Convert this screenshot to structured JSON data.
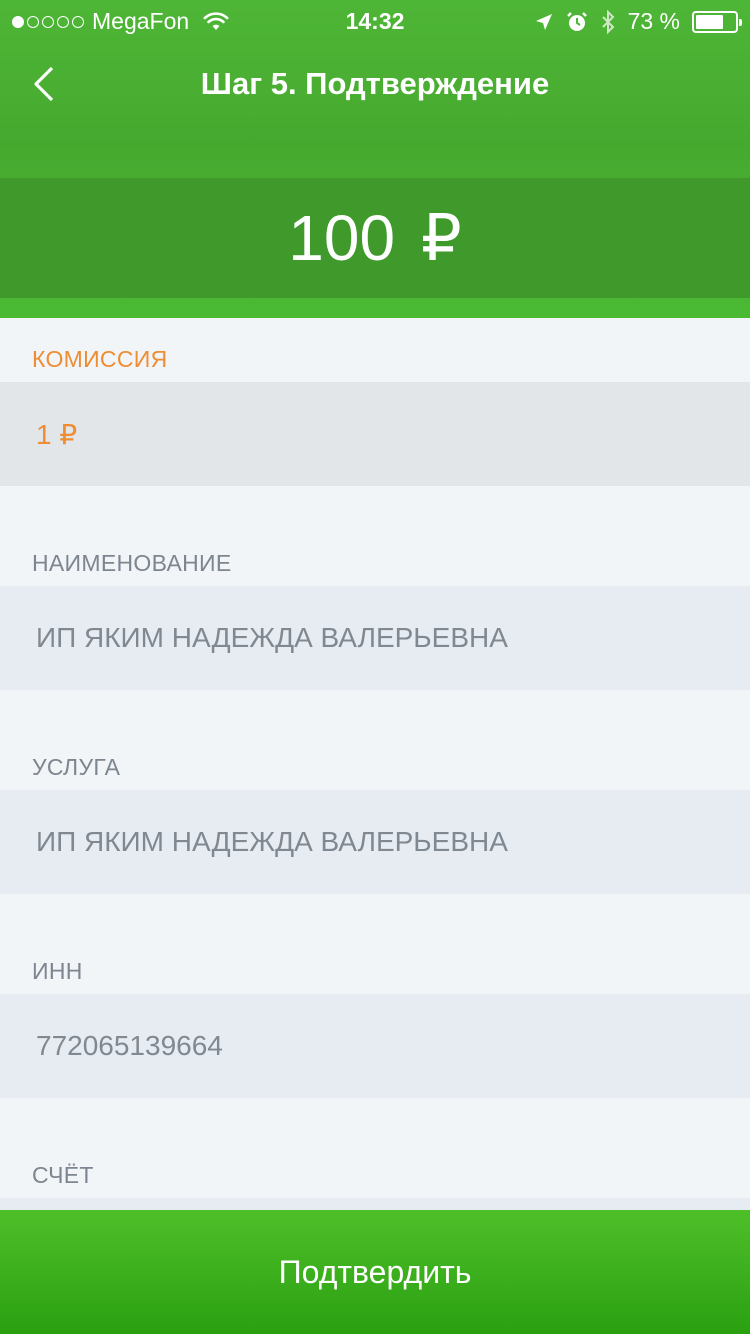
{
  "status_bar": {
    "carrier": "MegaFon",
    "signal_total": 5,
    "signal_filled": 1,
    "time": "14:32",
    "battery_text": "73 %",
    "battery_level": 0.73
  },
  "nav": {
    "title": "Шаг 5. Подтверждение"
  },
  "amount": {
    "value": "100",
    "currency": "₽"
  },
  "fields": {
    "commission_label": "КОМИССИЯ",
    "commission_value": "1 ₽",
    "name_label": "НАИМЕНОВАНИЕ",
    "name_value": "ИП ЯКИМ НАДЕЖДА ВАЛЕРЬЕВНА",
    "service_label": "УСЛУГА",
    "service_value": "ИП ЯКИМ НАДЕЖДА ВАЛЕРЬЕВНА",
    "inn_label": "ИНН",
    "inn_value": "772065139664",
    "account_label": "СЧЁТ"
  },
  "actions": {
    "confirm_label": "Подтвердить"
  },
  "colors": {
    "brand_green": "#4eb636",
    "accent_orange": "#ee8d32",
    "label_gray": "#7d8590"
  },
  "icons": {
    "back": "chevron-left-icon",
    "wifi": "wifi-icon",
    "location": "location-arrow-icon",
    "alarm": "alarm-icon",
    "bluetooth": "bluetooth-icon",
    "battery": "battery-icon"
  }
}
